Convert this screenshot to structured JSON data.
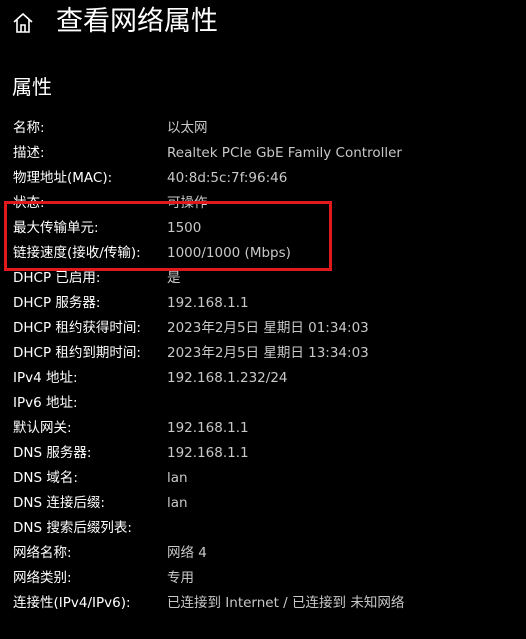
{
  "header": {
    "home_icon": "home-icon",
    "title": "查看网络属性"
  },
  "section": {
    "title": "属性"
  },
  "properties": [
    {
      "label": "名称:",
      "value": "以太网"
    },
    {
      "label": "描述:",
      "value": "Realtek PCIe GbE Family Controller"
    },
    {
      "label": "物理地址(MAC):",
      "value": "40:8d:5c:7f:96:46"
    },
    {
      "label": "状态:",
      "value": "可操作"
    },
    {
      "label": "最大传输单元:",
      "value": "1500"
    },
    {
      "label": "链接速度(接收/传输):",
      "value": "1000/1000 (Mbps)"
    },
    {
      "label": "DHCP 已启用:",
      "value": "是"
    },
    {
      "label": "DHCP 服务器:",
      "value": "192.168.1.1"
    },
    {
      "label": "DHCP 租约获得时间:",
      "value": "2023年2月5日 星期日 01:34:03"
    },
    {
      "label": "DHCP 租约到期时间:",
      "value": "2023年2月5日 星期日 13:34:03"
    },
    {
      "label": "IPv4 地址:",
      "value": "192.168.1.232/24"
    },
    {
      "label": "IPv6 地址:",
      "value": ""
    },
    {
      "label": "默认网关:",
      "value": "192.168.1.1"
    },
    {
      "label": "DNS 服务器:",
      "value": "192.168.1.1"
    },
    {
      "label": "DNS 域名:",
      "value": "lan"
    },
    {
      "label": "DNS 连接后缀:",
      "value": "lan"
    },
    {
      "label": "DNS 搜索后缀列表:",
      "value": ""
    },
    {
      "label": "网络名称:",
      "value": "网络 4"
    },
    {
      "label": "网络类别:",
      "value": "专用"
    },
    {
      "label": "连接性(IPv4/IPv6):",
      "value": "已连接到 Internet / 已连接到 未知网络"
    }
  ],
  "colors": {
    "background": "#000000",
    "label_text": "#ffffff",
    "value_text": "#c8c8c8",
    "highlight_border": "#e0191f"
  }
}
